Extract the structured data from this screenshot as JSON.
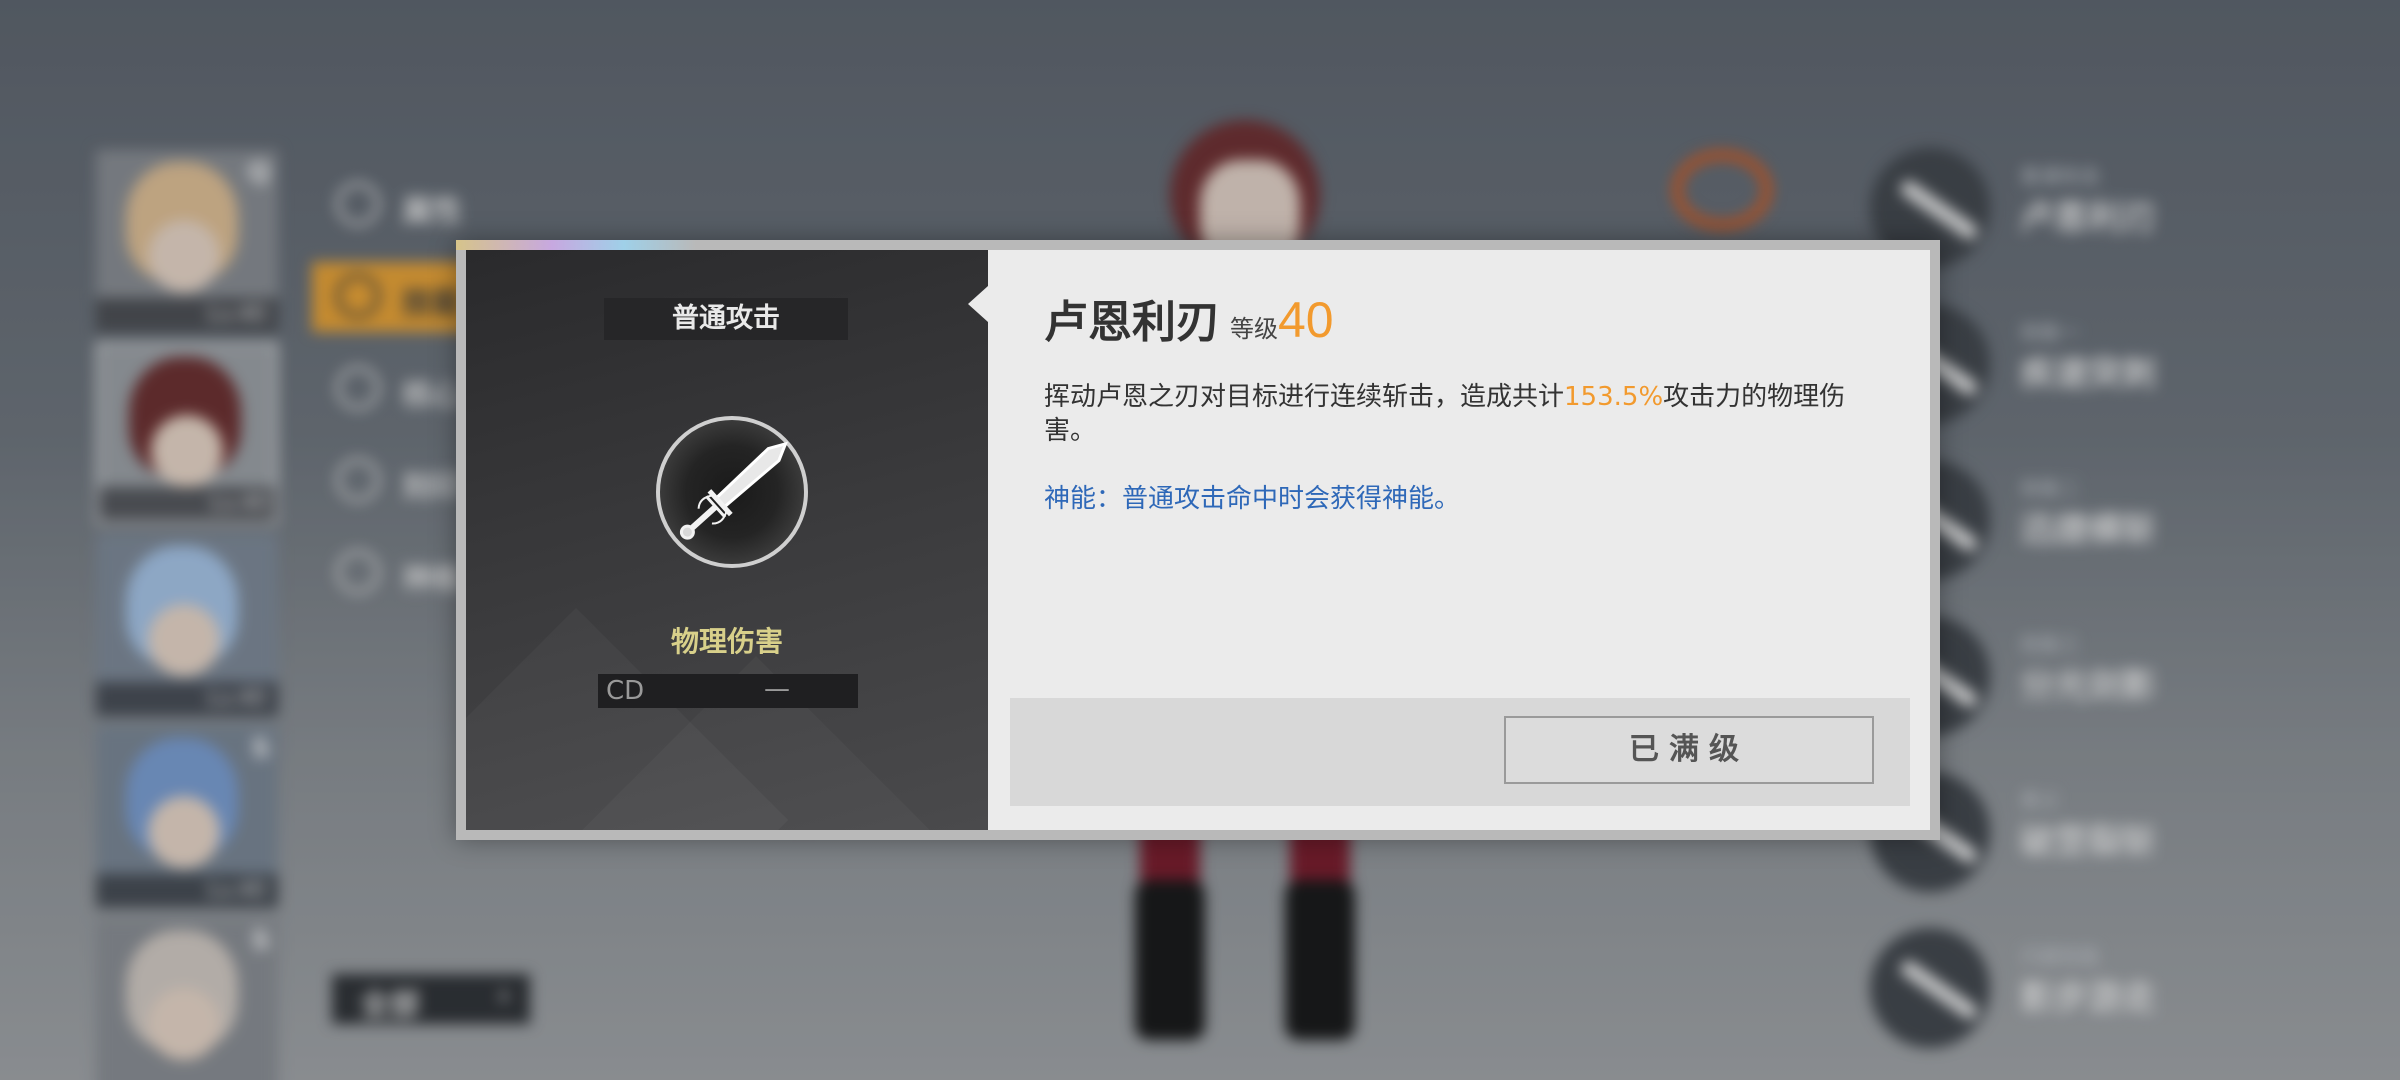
{
  "background": {
    "left_menu": [
      {
        "label": "属性",
        "active": false
      },
      {
        "label": "技能",
        "active": true
      },
      {
        "label": "核心",
        "active": false
      },
      {
        "label": "刻印",
        "active": false
      },
      {
        "label": "神格",
        "active": false
      }
    ],
    "all_button": {
      "label": "全部"
    },
    "skills_list": [
      {
        "sub": "普通攻击",
        "name": "卢恩利刃"
      },
      {
        "sub": "技能一",
        "name": "疾速突刺"
      },
      {
        "sub": "技能二",
        "name": "迅捷横斩"
      },
      {
        "sub": "技能三",
        "name": "分光剑影"
      },
      {
        "sub": "奥义",
        "name": "破罡裂斩"
      },
      {
        "sub": "闪避技能",
        "name": "影步游走"
      }
    ]
  },
  "dialog": {
    "left": {
      "type_tag": "普通攻击",
      "damage_type": "物理伤害",
      "cd_label": "CD",
      "cd_value": "—"
    },
    "right": {
      "name": "卢恩利刃",
      "level_label": "等级",
      "level_value": "40",
      "desc_prefix": "挥动卢恩之刃对目标进行连续斩击，造成共计",
      "desc_highlight": "153.5%",
      "desc_suffix": "攻击力的物理伤害。",
      "passive": "神能：普通攻击命中时会获得神能。",
      "max_button": "已满级"
    }
  },
  "colors": {
    "accent_orange": "#f29a2e",
    "passive_blue": "#2e68b8",
    "damage_type_yellow": "#d8d08a",
    "menu_active": "#f0a530"
  }
}
